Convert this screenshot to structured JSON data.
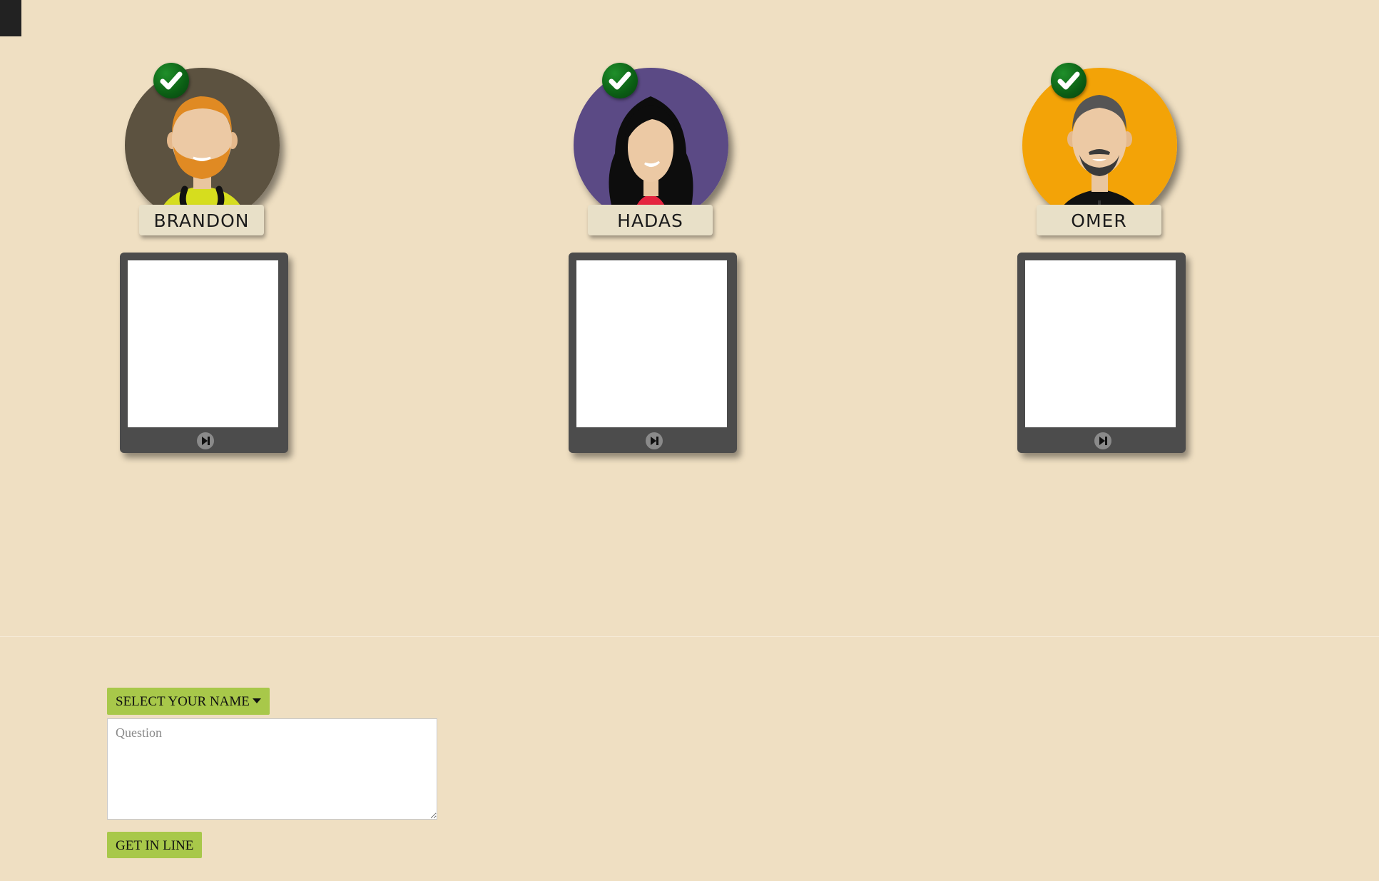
{
  "agents": [
    {
      "name": "BRANDON",
      "avatar_bg": "#5c5240",
      "status_icon": "check-icon"
    },
    {
      "name": "HADAS",
      "avatar_bg": "#5b4a85",
      "status_icon": "check-icon"
    },
    {
      "name": "OMER",
      "avatar_bg": "#f3a307",
      "status_icon": "check-icon"
    }
  ],
  "form": {
    "select_label": "SELECT YOUR NAME",
    "question_placeholder": "Question",
    "question_value": "",
    "submit_label": "GET IN LINE"
  },
  "colors": {
    "page_bg": "#efdfc2",
    "button_bg": "#a8c84a",
    "tablet": "#4c4c4c",
    "check_green": "#0b5e14"
  }
}
